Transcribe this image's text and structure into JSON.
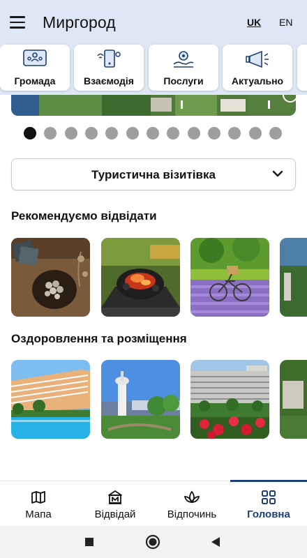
{
  "header": {
    "title": "Миргород",
    "lang_uk": "UK",
    "lang_en": "EN"
  },
  "categories": [
    {
      "label": "Громада",
      "icon": "community-icon"
    },
    {
      "label": "Взаємодія",
      "icon": "interaction-icon"
    },
    {
      "label": "Послуги",
      "icon": "services-icon"
    },
    {
      "label": "Актуально",
      "icon": "megaphone-icon"
    }
  ],
  "carousel": {
    "slides": 13,
    "active": 1
  },
  "visit_card": {
    "label": "Туристична візитівка"
  },
  "sections": {
    "recommended": {
      "title": "Рекомендуємо відвідати"
    },
    "wellness": {
      "title": "Оздоровлення та розміщення"
    }
  },
  "bottom_nav": [
    {
      "label": "Мапа",
      "icon": "map-icon"
    },
    {
      "label": "Відвідай",
      "icon": "museum-icon"
    },
    {
      "label": "Відпочинь",
      "icon": "lotus-icon"
    },
    {
      "label": "Головна",
      "icon": "grid-icon",
      "active": true
    }
  ],
  "colors": {
    "header_bg": "#dde7f6",
    "accent": "#1c3f75",
    "dot_inactive": "#9e9e9e",
    "dot_active": "#111111"
  }
}
